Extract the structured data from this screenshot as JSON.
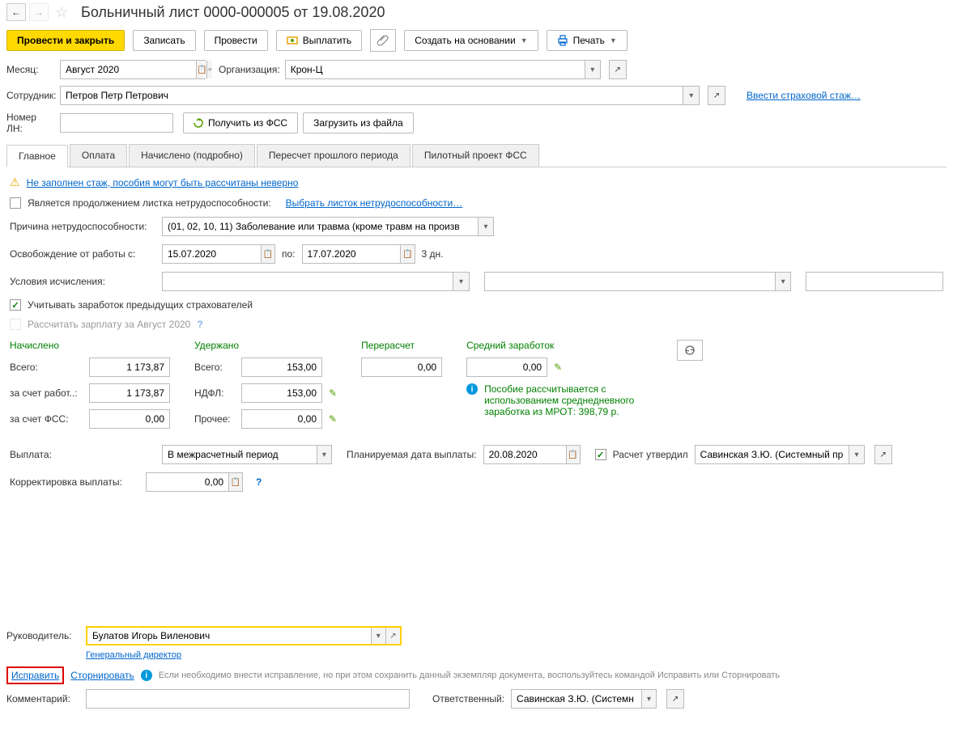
{
  "header": {
    "title": "Больничный лист 0000-000005 от 19.08.2020"
  },
  "toolbar": {
    "post_close": "Провести и закрыть",
    "save": "Записать",
    "post": "Провести",
    "pay": "Выплатить",
    "create_based": "Создать на основании",
    "print": "Печать"
  },
  "fields": {
    "month_label": "Месяц:",
    "month_value": "Август 2020",
    "org_label": "Организация:",
    "org_value": "Крон-Ц",
    "employee_label": "Сотрудник:",
    "employee_value": "Петров Петр Петрович",
    "insurance_link": "Ввести страховой стаж…",
    "ln_label": "Номер ЛН:",
    "ln_value": "",
    "get_fss": "Получить из ФСС",
    "load_file": "Загрузить из файла"
  },
  "tabs": {
    "main": "Главное",
    "payment": "Оплата",
    "accrued": "Начислено (подробно)",
    "recalc": "Пересчет прошлого периода",
    "pilot": "Пилотный проект ФСС"
  },
  "main_tab": {
    "warning": "Не заполнен стаж, пособия могут быть рассчитаны неверно",
    "continuation_label": "Является продолжением листка нетрудоспособности:",
    "select_sheet_link": "Выбрать листок нетрудоспособности…",
    "reason_label": "Причина нетрудоспособности:",
    "reason_value": "(01, 02, 10, 11) Заболевание или травма (кроме травм на произв",
    "release_label": "Освобождение от работы с:",
    "date_from": "15.07.2020",
    "date_to_label": "по:",
    "date_to": "17.07.2020",
    "days": "3 дн.",
    "conditions_label": "Условия исчисления:",
    "consider_prev": "Учитывать заработок предыдущих страхователей",
    "calc_salary": "Рассчитать зарплату за Август 2020"
  },
  "totals": {
    "accrued_head": "Начислено",
    "withheld_head": "Удержано",
    "recalc_head": "Перерасчет",
    "avg_head": "Средний заработок",
    "total_label": "Всего:",
    "employer_label": "за счет работ..:",
    "fss_label": "за счет ФСС:",
    "ndfl_label": "НДФЛ:",
    "other_label": "Прочее:",
    "accrued_total": "1 173,87",
    "accrued_employer": "1 173,87",
    "accrued_fss": "0,00",
    "withheld_total": "153,00",
    "withheld_ndfl": "153,00",
    "withheld_other": "0,00",
    "recalc_val": "0,00",
    "avg_val": "0,00",
    "info_text": "Пособие рассчитывается с использованием среднедневного заработка из МРОТ: 398,79 р."
  },
  "payout": {
    "label": "Выплата:",
    "value": "В межрасчетный период",
    "plan_date_label": "Планируемая дата выплаты:",
    "plan_date": "20.08.2020",
    "approved_label": "Расчет утвердил",
    "approved_by": "Савинская З.Ю. (Системный прогр",
    "correction_label": "Корректировка выплаты:",
    "correction_value": "0,00"
  },
  "footer": {
    "manager_label": "Руководитель:",
    "manager_value": "Булатов Игорь Виленович",
    "manager_position": "Генеральный директор",
    "fix_link": "Исправить",
    "storno_link": "Сторнировать",
    "note": "Если необходимо внести исправление, но при этом сохранить данный экземпляр документа, воспользуйтесь командой Исправить или Сторнировать",
    "comment_label": "Комментарий:",
    "comment_value": "",
    "responsible_label": "Ответственный:",
    "responsible_value": "Савинская З.Ю. (Системн"
  }
}
